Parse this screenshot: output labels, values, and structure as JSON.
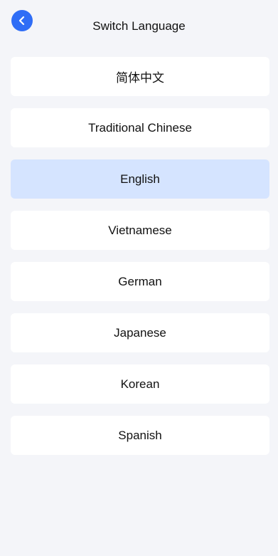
{
  "header": {
    "title": "Switch Language",
    "back_icon": "chevron-left-icon",
    "accent_color": "#2f6df6"
  },
  "languages": {
    "items": [
      {
        "label": "简体中文",
        "selected": false
      },
      {
        "label": "Traditional Chinese",
        "selected": false
      },
      {
        "label": "English",
        "selected": true
      },
      {
        "label": "Vietnamese",
        "selected": false
      },
      {
        "label": "German",
        "selected": false
      },
      {
        "label": "Japanese",
        "selected": false
      },
      {
        "label": "Korean",
        "selected": false
      },
      {
        "label": "Spanish",
        "selected": false
      }
    ],
    "selected_color": "#d5e4ff"
  }
}
